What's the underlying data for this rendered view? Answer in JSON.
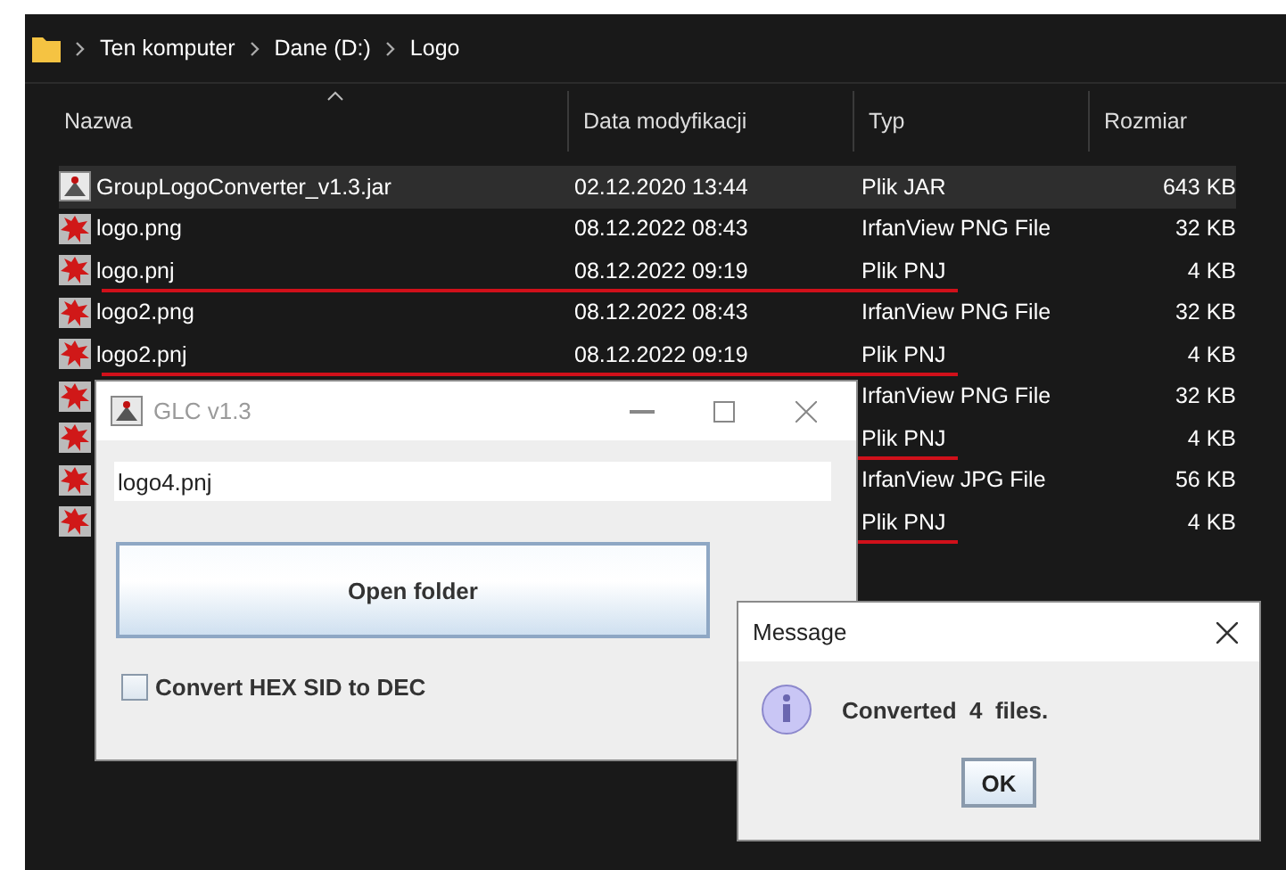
{
  "explorer": {
    "breadcrumb": [
      "Ten komputer",
      "Dane (D:)",
      "Logo"
    ],
    "columns": [
      "Nazwa",
      "Data modyfikacji",
      "Typ",
      "Rozmiar"
    ],
    "files": [
      {
        "kind": "jar",
        "name": "GroupLogoConverter_v1.3.jar",
        "date": "02.12.2020 13:44",
        "type": "Plik JAR",
        "size": "643 KB",
        "selected": true,
        "underlined": false
      },
      {
        "kind": "image",
        "name": "logo.png",
        "date": "08.12.2022 08:43",
        "type": "IrfanView PNG File",
        "size": "32 KB",
        "selected": false,
        "underlined": false
      },
      {
        "kind": "image",
        "name": "logo.pnj",
        "date": "08.12.2022 09:19",
        "type": "Plik PNJ",
        "size": "4 KB",
        "selected": false,
        "underlined": true
      },
      {
        "kind": "image",
        "name": "logo2.png",
        "date": "08.12.2022 08:43",
        "type": "IrfanView PNG File",
        "size": "32 KB",
        "selected": false,
        "underlined": false
      },
      {
        "kind": "image",
        "name": "logo2.pnj",
        "date": "08.12.2022 09:19",
        "type": "Plik PNJ",
        "size": "4 KB",
        "selected": false,
        "underlined": true
      },
      {
        "kind": "image",
        "type": "IrfanView PNG File",
        "size": "32 KB",
        "selected": false,
        "underlined": false
      },
      {
        "kind": "image",
        "type": "Plik PNJ",
        "size": "4 KB",
        "selected": false,
        "underlined": true
      },
      {
        "kind": "image",
        "type": "IrfanView JPG File",
        "size": "56 KB",
        "selected": false,
        "underlined": false
      },
      {
        "kind": "image",
        "type": "Plik PNJ",
        "size": "4 KB",
        "selected": false,
        "underlined": true
      }
    ]
  },
  "glc_window": {
    "title": "GLC v1.3",
    "field_value": "logo4.pnj",
    "button": "Open folder",
    "checkbox": {
      "label": "Convert HEX SID to DEC",
      "checked": false
    }
  },
  "message_dialog": {
    "title": "Message",
    "text": "Converted  4  files.",
    "button": "OK"
  }
}
